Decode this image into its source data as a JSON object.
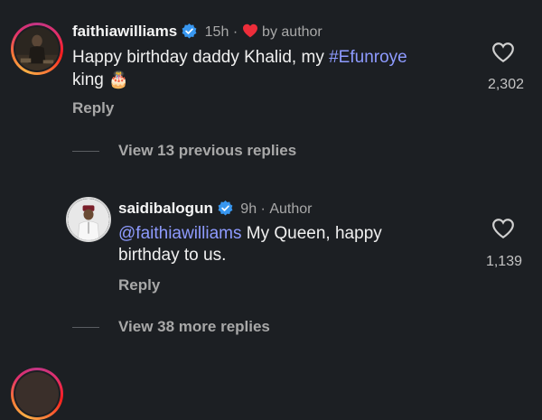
{
  "colors": {
    "background": "#1c1f23",
    "link": "#8e9bff",
    "verified": "#3897f0",
    "author_heart": "#ed2d3a"
  },
  "comments": [
    {
      "username": "faithiawilliams",
      "time": "15h",
      "separator": "·",
      "author_label": "by author",
      "text_before": "Happy birthday daddy Khalid, my ",
      "hashtag": "#Efunroye",
      "text_after": "king",
      "emoji": "🎂",
      "likes": "2,302",
      "reply_label": "Reply",
      "icons": [
        "verified-badge-icon",
        "heart-icon",
        "like-heart-icon"
      ]
    },
    {
      "username": "saidibalogun",
      "time": "9h",
      "separator": "·",
      "author_label": "Author",
      "mention": "@faithiawilliams",
      "text_line1": " My Queen, happy",
      "text_line2": "birthday to us.",
      "likes": "1,139",
      "reply_label": "Reply",
      "icons": [
        "verified-badge-icon",
        "like-heart-icon"
      ]
    }
  ],
  "view_previous": "View 13 previous replies",
  "view_more": "View 38 more replies"
}
